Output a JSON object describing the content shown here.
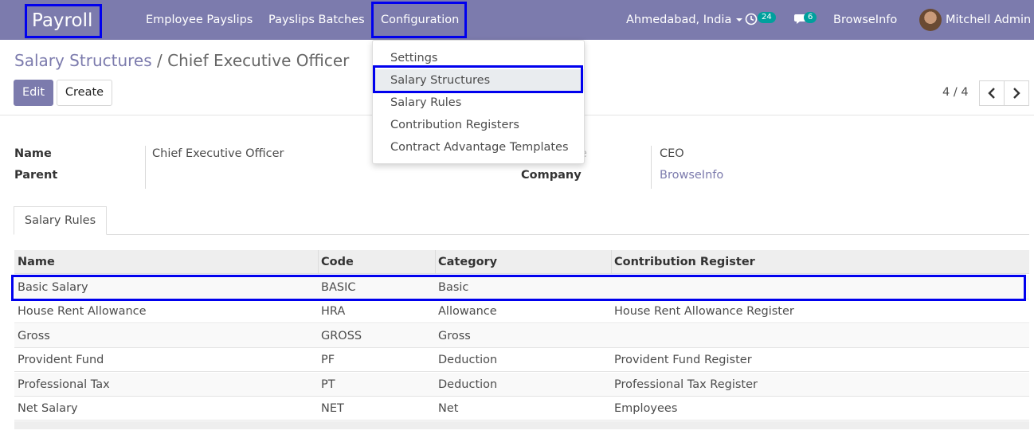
{
  "navbar": {
    "brand": "Payroll",
    "menu": [
      "Employee Payslips",
      "Payslips Batches",
      "Configuration"
    ],
    "company": "Ahmedabad, India",
    "activity_badge": "24",
    "messages_badge": "6",
    "browseinfo": "BrowseInfo",
    "user": "Mitchell Admin"
  },
  "breadcrumb": {
    "parent": "Salary Structures",
    "separator": "/",
    "current": "Chief Executive Officer"
  },
  "buttons": {
    "edit": "Edit",
    "create": "Create"
  },
  "pager": {
    "value": "4 / 4"
  },
  "form": {
    "name_label": "Name",
    "name_value": "Chief Executive Officer",
    "parent_label": "Parent",
    "parent_value": "",
    "reference_value": "CEO",
    "company_label": "Company",
    "company_value": "BrowseInfo"
  },
  "tab": {
    "label": "Salary Rules"
  },
  "table": {
    "headers": [
      "Name",
      "Code",
      "Category",
      "Contribution Register"
    ],
    "rows": [
      [
        "Basic Salary",
        "BASIC",
        "Basic",
        ""
      ],
      [
        "House Rent Allowance",
        "HRA",
        "Allowance",
        "House Rent Allowance Register"
      ],
      [
        "Gross",
        "GROSS",
        "Gross",
        ""
      ],
      [
        "Provident Fund",
        "PF",
        "Deduction",
        "Provident Fund Register"
      ],
      [
        "Professional Tax",
        "PT",
        "Deduction",
        "Professional Tax Register"
      ],
      [
        "Net Salary",
        "NET",
        "Net",
        "Employees"
      ]
    ]
  },
  "dropdown": {
    "items": [
      "Settings",
      "Salary Structures",
      "Salary Rules",
      "Contribution Registers",
      "Contract Advantage Templates"
    ],
    "active": "Salary Structures",
    "peek_fragment": "e"
  },
  "colors": {
    "brand": "#7c7bad",
    "highlight": "#0000ee",
    "badge": "#00a09d"
  }
}
